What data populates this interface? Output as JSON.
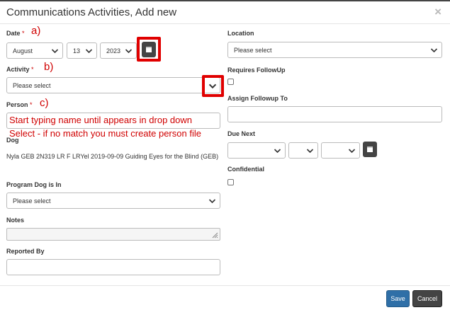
{
  "dialog": {
    "title": "Communications Activities, Add new"
  },
  "date": {
    "label": "Date",
    "required": "*",
    "annotation": "a)",
    "month": "August",
    "day": "13",
    "year": "2023"
  },
  "activity": {
    "label": "Activity",
    "required": "*",
    "annotation": "b)",
    "value": "Please select"
  },
  "person": {
    "label": "Person",
    "required": "*",
    "annotation": "c)",
    "value": "Start typing name until appears in drop down",
    "note": "Select - if no match you must create person file"
  },
  "dog": {
    "label": "Dog",
    "value": "Nyla GEB 2N319 LR F LRYel 2019-09-09 Guiding Eyes for the Blind (GEB)"
  },
  "program_dog": {
    "label": "Program Dog is In",
    "value": "Please select"
  },
  "notes": {
    "label": "Notes",
    "value": ""
  },
  "reported_by": {
    "label": "Reported By",
    "value": ""
  },
  "location": {
    "label": "Location",
    "value": "Please select"
  },
  "requires_followup": {
    "label": "Requires FollowUp",
    "checked": false
  },
  "assign_followup": {
    "label": "Assign Followup To",
    "value": ""
  },
  "due_next": {
    "label": "Due Next",
    "month": "",
    "day": "",
    "year": ""
  },
  "confidential": {
    "label": "Confidential",
    "checked": false
  },
  "buttons": {
    "save": "Save",
    "cancel": "Cancel"
  },
  "icons": {
    "close": "close-icon",
    "calendar": "calendar-icon",
    "chevron": "chevron-down-icon"
  },
  "colors": {
    "annotation": "#d00000",
    "save_button": "#2f6fa7",
    "cancel_button": "#444444"
  }
}
